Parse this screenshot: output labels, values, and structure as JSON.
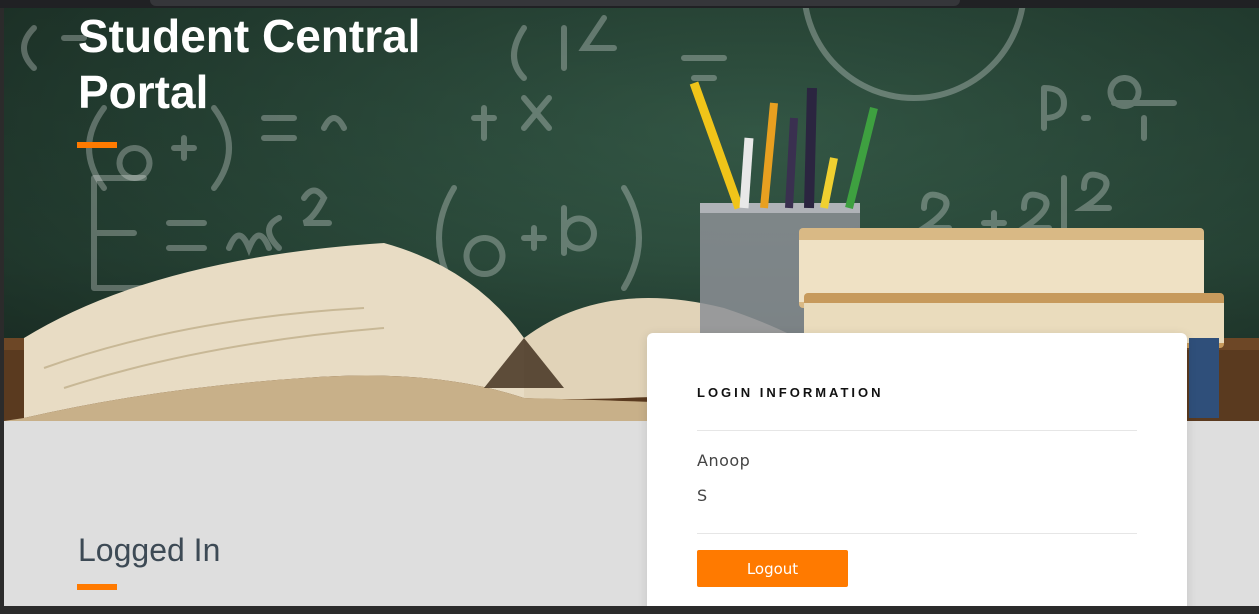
{
  "hero": {
    "title": "Student Central Portal"
  },
  "main": {
    "section_title": "Logged In"
  },
  "login_card": {
    "heading": "LOGIN INFORMATION",
    "first_name": "Anoop",
    "last_name": "S",
    "logout_label": "Logout"
  },
  "colors": {
    "accent": "#ff7a00",
    "card_background": "#ffffff",
    "page_background": "#dedede",
    "chalkboard": "#2c4d3d"
  }
}
